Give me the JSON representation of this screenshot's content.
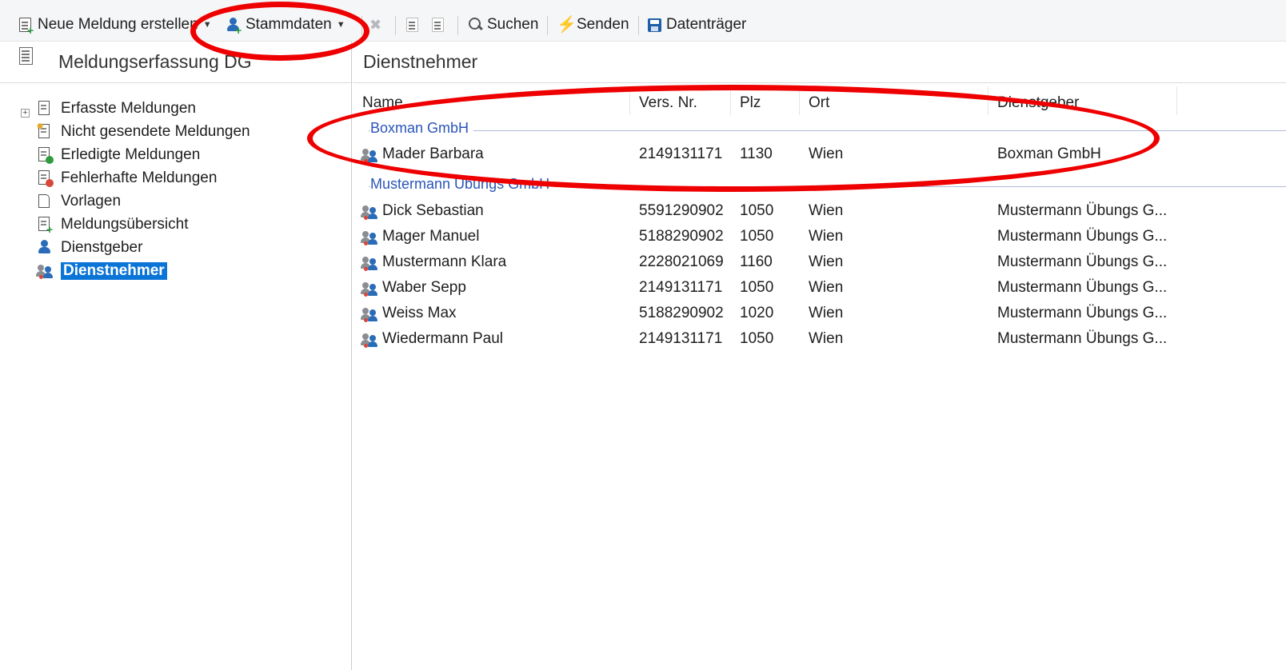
{
  "toolbar": {
    "new_report": "Neue Meldung erstellen",
    "master_data": "Stammdaten",
    "search": "Suchen",
    "send": "Senden",
    "data_carrier": "Datenträger"
  },
  "left": {
    "title": "Meldungserfassung DG",
    "items": [
      {
        "label": "Erfasste Meldungen"
      },
      {
        "label": "Nicht gesendete Meldungen"
      },
      {
        "label": "Erledigte Meldungen"
      },
      {
        "label": "Fehlerhafte Meldungen"
      },
      {
        "label": "Vorlagen"
      },
      {
        "label": "Meldungsübersicht"
      },
      {
        "label": "Dienstgeber"
      },
      {
        "label": "Dienstnehmer"
      }
    ]
  },
  "right": {
    "title": "Dienstnehmer",
    "columns": [
      "Name",
      "Vers. Nr.",
      "Plz",
      "Ort",
      "Dienstgeber"
    ],
    "groups": [
      {
        "name": "Boxman GmbH",
        "rows": [
          [
            "Mader Barbara",
            "2149131171",
            "1130",
            "Wien",
            "Boxman GmbH"
          ]
        ]
      },
      {
        "name": "Mustermann Übungs GmbH",
        "rows": [
          [
            "Dick Sebastian",
            "5591290902",
            "1050",
            "Wien",
            "Mustermann Übungs G..."
          ],
          [
            "Mager Manuel",
            "5188290902",
            "1050",
            "Wien",
            "Mustermann Übungs G..."
          ],
          [
            "Mustermann Klara",
            "2228021069",
            "1160",
            "Wien",
            "Mustermann Übungs G..."
          ],
          [
            "Waber Sepp",
            "2149131171",
            "1050",
            "Wien",
            "Mustermann Übungs G..."
          ],
          [
            "Weiss Max",
            "5188290902",
            "1020",
            "Wien",
            "Mustermann Übungs G..."
          ],
          [
            "Wiedermann Paul",
            "2149131171",
            "1050",
            "Wien",
            "Mustermann Übungs G..."
          ]
        ]
      }
    ]
  },
  "colors": {
    "selection": "#0b74d7",
    "group_text": "#2a55b8",
    "annotation": "#ee0000"
  }
}
